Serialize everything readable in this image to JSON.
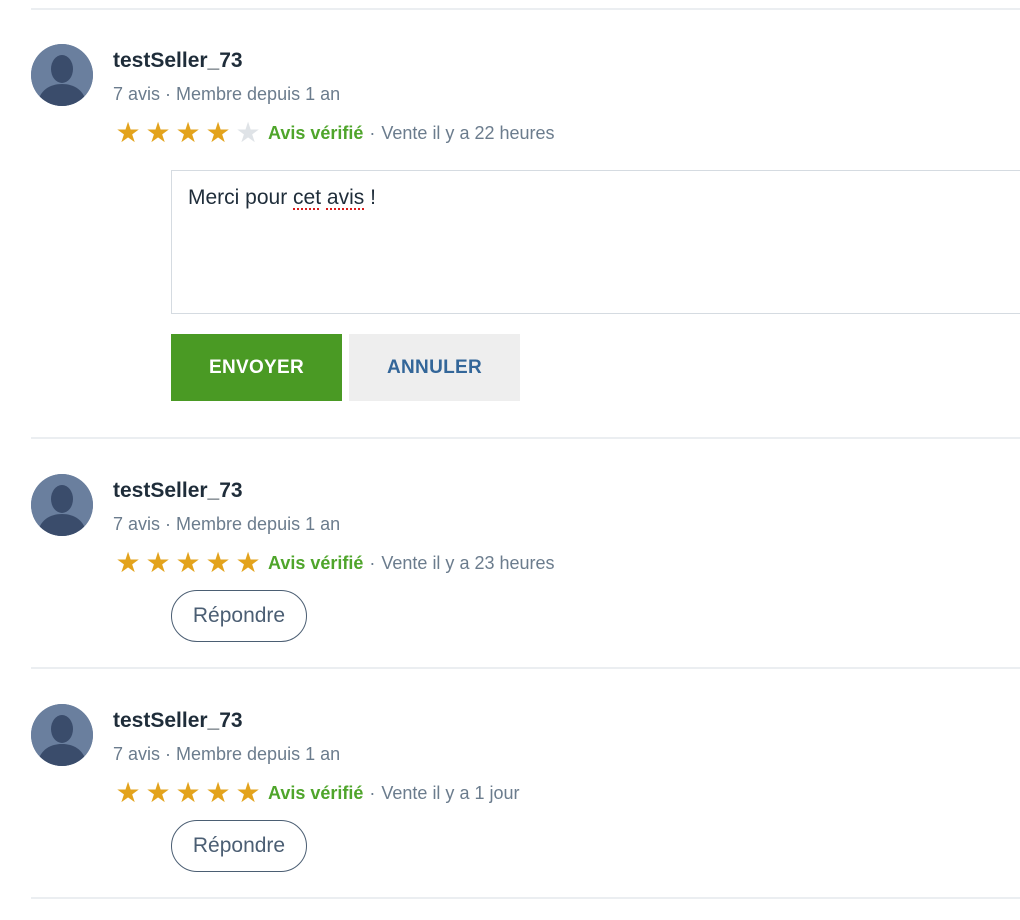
{
  "colors": {
    "star_filled": "#e3a31c",
    "star_empty": "#dfe3e7",
    "verified_green": "#4fa52b",
    "send_button_bg": "#4a9a24",
    "cancel_button_text": "#336699",
    "meta_text": "#6b7c8d"
  },
  "icons": {
    "avatar": "default-user-silhouette-icon",
    "star": "star-icon"
  },
  "reviews": [
    {
      "username": "testSeller_73",
      "meta": "7 avis · Membre depuis 1 an",
      "rating": 4,
      "max_rating": 5,
      "verified_label": "Avis vérifié",
      "separator": "·",
      "sale_time": "Vente il y a 22 heures",
      "reply_form": {
        "text_before": "Merci pour ",
        "misspelled_1": "cet",
        "text_middle": " ",
        "misspelled_2": "avis",
        "text_after": " !",
        "send_label": "ENVOYER",
        "cancel_label": "ANNULER"
      }
    },
    {
      "username": "testSeller_73",
      "meta": "7 avis · Membre depuis 1 an",
      "rating": 5,
      "max_rating": 5,
      "verified_label": "Avis vérifié",
      "separator": "·",
      "sale_time": "Vente il y a 23 heures",
      "reply_label": "Répondre"
    },
    {
      "username": "testSeller_73",
      "meta": "7 avis · Membre depuis 1 an",
      "rating": 5,
      "max_rating": 5,
      "verified_label": "Avis vérifié",
      "separator": "·",
      "sale_time": "Vente il y a 1 jour",
      "reply_label": "Répondre"
    }
  ]
}
